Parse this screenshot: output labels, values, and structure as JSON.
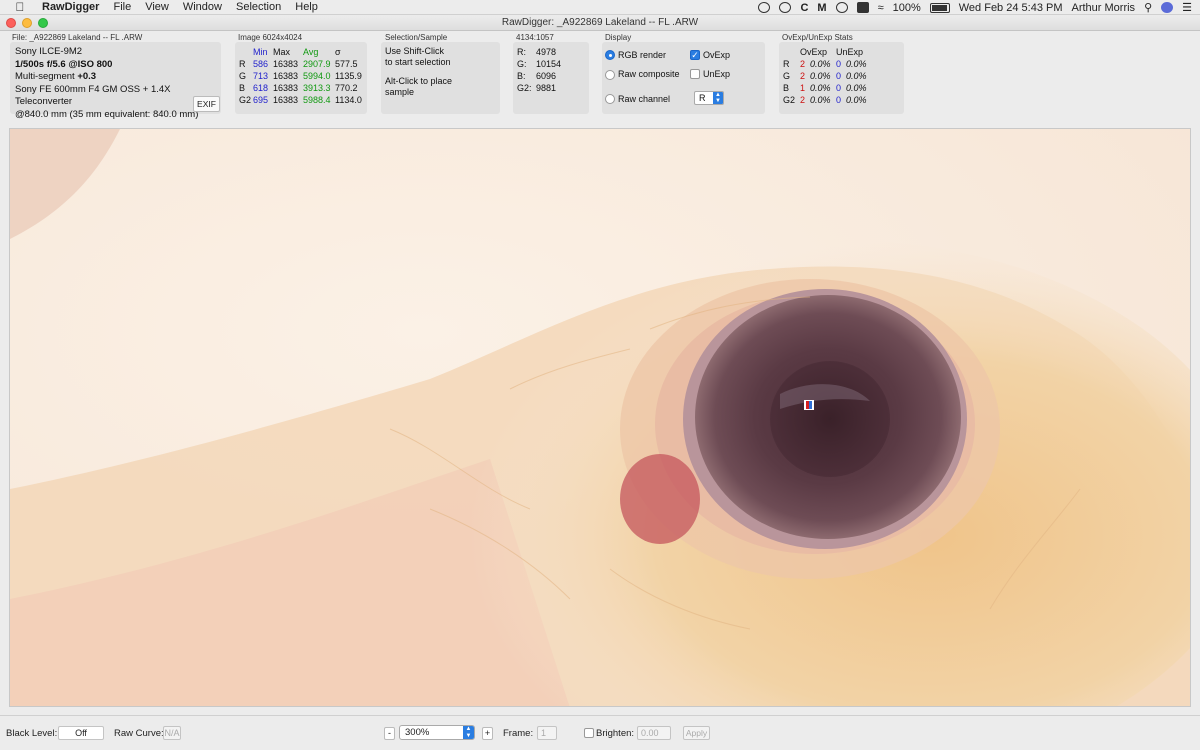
{
  "menubar": {
    "app_name": "RawDigger",
    "items": [
      "File",
      "View",
      "Window",
      "Selection",
      "Help"
    ],
    "battery": "100%",
    "clock": "Wed Feb 24  5:43 PM",
    "user": "Arthur Morris"
  },
  "window": {
    "title": "RawDigger: _A922869 Lakeland  -- FL .ARW"
  },
  "file_panel": {
    "label": "File: _A922869 Lakeland  -- FL .ARW",
    "camera": "Sony ILCE-9M2",
    "exposure": "1/500s f/5.6 @ISO 800",
    "metering_prefix": "Multi-segment ",
    "metering_ev": "+0.3",
    "lens": "Sony FE 600mm F4 GM OSS + 1.4X Teleconverter",
    "focal": "@840.0 mm (35 mm equivalent: 840.0 mm)",
    "exif_button": "EXIF"
  },
  "image_panel": {
    "label": "Image 6024x4024",
    "headers": [
      "",
      "Min",
      "Max",
      "Avg",
      "σ"
    ],
    "rows": [
      {
        "ch": "R",
        "min": "586",
        "max": "16383",
        "avg": "2907.9",
        "sigma": "577.5"
      },
      {
        "ch": "G",
        "min": "713",
        "max": "16383",
        "avg": "5994.0",
        "sigma": "1135.9"
      },
      {
        "ch": "B",
        "min": "618",
        "max": "16383",
        "avg": "3913.3",
        "sigma": "770.2"
      },
      {
        "ch": "G2",
        "min": "695",
        "max": "16383",
        "avg": "5988.4",
        "sigma": "1134.0"
      }
    ]
  },
  "selection_panel": {
    "label": "Selection/Sample",
    "line1": "Use Shift-Click",
    "line2": "to start selection",
    "line3": "Alt-Click to place",
    "line4": "sample"
  },
  "sample_panel": {
    "label": "4134:1057",
    "rows": [
      {
        "k": "R:",
        "v": "4978"
      },
      {
        "k": "G:",
        "v": "10154"
      },
      {
        "k": "B:",
        "v": "6096"
      },
      {
        "k": "G2:",
        "v": "9881"
      }
    ]
  },
  "display_panel": {
    "label": "Display",
    "rgb_render": "RGB render",
    "raw_composite": "Raw composite",
    "raw_channel": "Raw channel",
    "ovexp": "OvExp",
    "unexp": "UnExp",
    "channel_value": "R",
    "selected_mode": "RGB render",
    "ovexp_checked": true,
    "unexp_checked": false
  },
  "ov_panel": {
    "label": "OvExp/UnExp Stats",
    "headers": [
      "",
      "OvExp",
      "",
      "UnExp",
      ""
    ],
    "rows": [
      {
        "ch": "R",
        "ov": "2",
        "ovp": "0.0%",
        "un": "0",
        "unp": "0.0%"
      },
      {
        "ch": "G",
        "ov": "2",
        "ovp": "0.0%",
        "un": "0",
        "unp": "0.0%"
      },
      {
        "ch": "B",
        "ov": "1",
        "ovp": "0.0%",
        "un": "0",
        "unp": "0.0%"
      },
      {
        "ch": "G2",
        "ov": "2",
        "ovp": "0.0%",
        "un": "0",
        "unp": "0.0%"
      }
    ]
  },
  "bottombar": {
    "black_level_label": "Black Level:",
    "black_level_value": "Off",
    "raw_curve_label": "Raw Curve:",
    "raw_curve_value": "N/A",
    "zoom_minus": "-",
    "zoom_value": "300%",
    "zoom_plus": "+",
    "frame_label": "Frame:",
    "frame_value": "1",
    "brighten_label": "Brighten:",
    "brighten_value": "0.00",
    "apply_label": "Apply"
  },
  "colors": {
    "accent": "#2a7de1",
    "min_blue": "#2222cc",
    "avg_green": "#119911",
    "overexposed_red": "#cc1111"
  }
}
